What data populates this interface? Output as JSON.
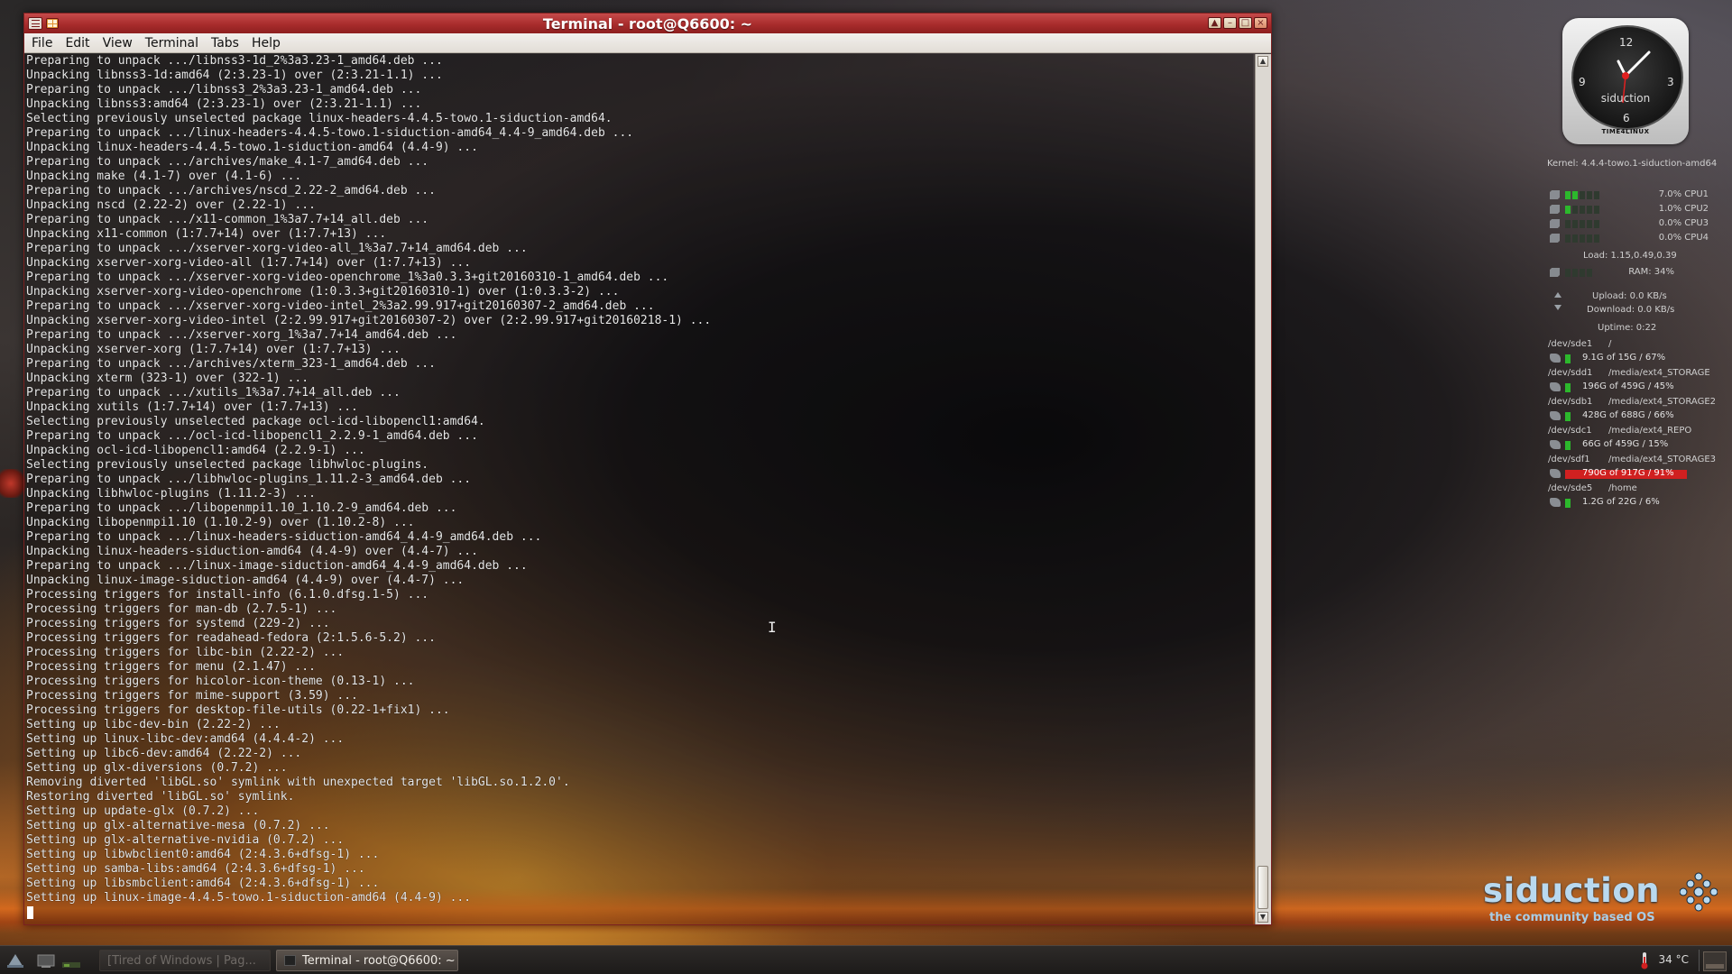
{
  "window": {
    "title": "Terminal - root@Q6600: ~",
    "controls": {
      "up": "▲",
      "minimize": "–",
      "maximize": "□",
      "close": "×"
    }
  },
  "menu": {
    "items": [
      "File",
      "Edit",
      "View",
      "Terminal",
      "Tabs",
      "Help"
    ]
  },
  "terminal": {
    "lines": [
      "Preparing to unpack .../libnss3-1d_2%3a3.23-1_amd64.deb ...",
      "Unpacking libnss3-1d:amd64 (2:3.23-1) over (2:3.21-1.1) ...",
      "Preparing to unpack .../libnss3_2%3a3.23-1_amd64.deb ...",
      "Unpacking libnss3:amd64 (2:3.23-1) over (2:3.21-1.1) ...",
      "Selecting previously unselected package linux-headers-4.4.5-towo.1-siduction-amd64.",
      "Preparing to unpack .../linux-headers-4.4.5-towo.1-siduction-amd64_4.4-9_amd64.deb ...",
      "Unpacking linux-headers-4.4.5-towo.1-siduction-amd64 (4.4-9) ...",
      "Preparing to unpack .../archives/make_4.1-7_amd64.deb ...",
      "Unpacking make (4.1-7) over (4.1-6) ...",
      "Preparing to unpack .../archives/nscd_2.22-2_amd64.deb ...",
      "Unpacking nscd (2.22-2) over (2.22-1) ...",
      "Preparing to unpack .../x11-common_1%3a7.7+14_all.deb ...",
      "Unpacking x11-common (1:7.7+14) over (1:7.7+13) ...",
      "Preparing to unpack .../xserver-xorg-video-all_1%3a7.7+14_amd64.deb ...",
      "Unpacking xserver-xorg-video-all (1:7.7+14) over (1:7.7+13) ...",
      "Preparing to unpack .../xserver-xorg-video-openchrome_1%3a0.3.3+git20160310-1_amd64.deb ...",
      "Unpacking xserver-xorg-video-openchrome (1:0.3.3+git20160310-1) over (1:0.3.3-2) ...",
      "Preparing to unpack .../xserver-xorg-video-intel_2%3a2.99.917+git20160307-2_amd64.deb ...",
      "Unpacking xserver-xorg-video-intel (2:2.99.917+git20160307-2) over (2:2.99.917+git20160218-1) ...",
      "Preparing to unpack .../xserver-xorg_1%3a7.7+14_amd64.deb ...",
      "Unpacking xserver-xorg (1:7.7+14) over (1:7.7+13) ...",
      "Preparing to unpack .../archives/xterm_323-1_amd64.deb ...",
      "Unpacking xterm (323-1) over (322-1) ...",
      "Preparing to unpack .../xutils_1%3a7.7+14_all.deb ...",
      "Unpacking xutils (1:7.7+14) over (1:7.7+13) ...",
      "Selecting previously unselected package ocl-icd-libopencl1:amd64.",
      "Preparing to unpack .../ocl-icd-libopencl1_2.2.9-1_amd64.deb ...",
      "Unpacking ocl-icd-libopencl1:amd64 (2.2.9-1) ...",
      "Selecting previously unselected package libhwloc-plugins.",
      "Preparing to unpack .../libhwloc-plugins_1.11.2-3_amd64.deb ...",
      "Unpacking libhwloc-plugins (1.11.2-3) ...",
      "Preparing to unpack .../libopenmpi1.10_1.10.2-9_amd64.deb ...",
      "Unpacking libopenmpi1.10 (1.10.2-9) over (1.10.2-8) ...",
      "Preparing to unpack .../linux-headers-siduction-amd64_4.4-9_amd64.deb ...",
      "Unpacking linux-headers-siduction-amd64 (4.4-9) over (4.4-7) ...",
      "Preparing to unpack .../linux-image-siduction-amd64_4.4-9_amd64.deb ...",
      "Unpacking linux-image-siduction-amd64 (4.4-9) over (4.4-7) ...",
      "Processing triggers for install-info (6.1.0.dfsg.1-5) ...",
      "Processing triggers for man-db (2.7.5-1) ...",
      "Processing triggers for systemd (229-2) ...",
      "Processing triggers for readahead-fedora (2:1.5.6-5.2) ...",
      "Processing triggers for libc-bin (2.22-2) ...",
      "Processing triggers for menu (2.1.47) ...",
      "Processing triggers for hicolor-icon-theme (0.13-1) ...",
      "Processing triggers for mime-support (3.59) ...",
      "Processing triggers for desktop-file-utils (0.22-1+fix1) ...",
      "Setting up libc-dev-bin (2.22-2) ...",
      "Setting up linux-libc-dev:amd64 (4.4.4-2) ...",
      "Setting up libc6-dev:amd64 (2.22-2) ...",
      "Setting up glx-diversions (0.7.2) ...",
      "Removing diverted 'libGL.so' symlink with unexpected target 'libGL.so.1.2.0'.",
      "Restoring diverted 'libGL.so' symlink.",
      "Setting up update-glx (0.7.2) ...",
      "Setting up glx-alternative-mesa (0.7.2) ...",
      "Setting up glx-alternative-nvidia (0.7.2) ...",
      "Setting up libwbclient0:amd64 (2:4.3.6+dfsg-1) ...",
      "Setting up samba-libs:amd64 (2:4.3.6+dfsg-1) ...",
      "Setting up libsmbclient:amd64 (2:4.3.6+dfsg-1) ...",
      "Setting up linux-image-4.4.5-towo.1-siduction-amd64 (4.4-9) ..."
    ]
  },
  "conky": {
    "clock": {
      "numbers": [
        "12",
        "3",
        "6",
        "9"
      ],
      "label": "siduction",
      "brand": "TIME4LINUX"
    },
    "kernel": "Kernel: 4.4.4-towo.1-siduction-amd64",
    "cpus": [
      {
        "label": "7.0% CPU1",
        "percent": 7.0
      },
      {
        "label": "1.0% CPU2",
        "percent": 1.0
      },
      {
        "label": "0.0% CPU3",
        "percent": 0.0
      },
      {
        "label": "0.0% CPU4",
        "percent": 0.0
      }
    ],
    "load": "Load: 1.15,0.49,0.39",
    "ram": {
      "label": "RAM: 34%",
      "percent": 34
    },
    "upload": "Upload: 0.0 KB/s",
    "download": "Download: 0.0 KB/s",
    "uptime": "Uptime: 0:22",
    "disks": [
      {
        "device": "/dev/sde1",
        "mount": "/",
        "usage": "9.1G of 15G / 67%",
        "percent": 67,
        "alert": false
      },
      {
        "device": "/dev/sdd1",
        "mount": "/media/ext4_STORAGE",
        "usage": "196G of 459G / 45%",
        "percent": 45,
        "alert": false
      },
      {
        "device": "/dev/sdb1",
        "mount": "/media/ext4_STORAGE2",
        "usage": "428G of 688G / 66%",
        "percent": 66,
        "alert": false
      },
      {
        "device": "/dev/sdc1",
        "mount": "/media/ext4_REPO",
        "usage": "66G of 459G / 15%",
        "percent": 15,
        "alert": false
      },
      {
        "device": "/dev/sdf1",
        "mount": "/media/ext4_STORAGE3",
        "usage": "790G of 917G / 91%",
        "percent": 91,
        "alert": true
      },
      {
        "device": "/dev/sde5",
        "mount": "/home",
        "usage": "1.2G of 22G / 6%",
        "percent": 6,
        "alert": false
      }
    ]
  },
  "logo": {
    "word": "siduction",
    "tagline": "the community based OS"
  },
  "taskbar": {
    "tasks": [
      {
        "label": "[Tired of Windows | Pag...",
        "active": false
      },
      {
        "label": "Terminal - root@Q6600: ~",
        "active": true
      }
    ],
    "temperature": "34 °C"
  },
  "colors": {
    "titlebar": "#a82c2c",
    "cpu_bar": "#2cb82c",
    "disk_alert": "#d02020",
    "logo": "#b9d9ef"
  }
}
